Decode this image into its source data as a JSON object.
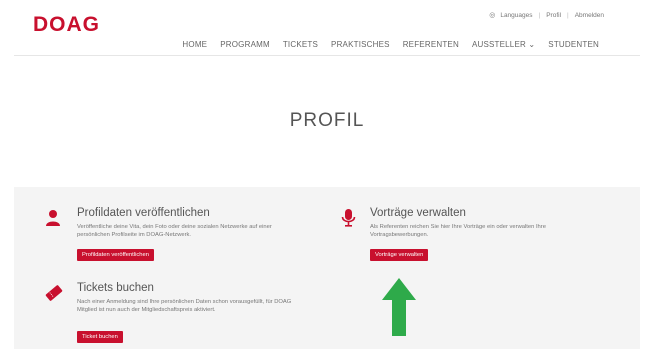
{
  "brand": {
    "logo": "DOAG"
  },
  "toplinks": {
    "languages": "Languages",
    "profil": "Profil",
    "abmelden": "Abmelden",
    "separator": "|"
  },
  "nav": {
    "items": [
      {
        "label": "HOME"
      },
      {
        "label": "PROGRAMM"
      },
      {
        "label": "TICKETS"
      },
      {
        "label": "PRAKTISCHES"
      },
      {
        "label": "REFERENTEN"
      },
      {
        "label": "AUSSTELLER ⌄"
      },
      {
        "label": "STUDENTEN"
      }
    ]
  },
  "page": {
    "title": "PROFIL"
  },
  "cards": {
    "profil": {
      "icon": "user-icon",
      "title": "Profildaten veröffentlichen",
      "text": "Veröffentliche deine Vita, dein Foto oder deine sozialen Netzwerke auf einer persönlichen Profilseite im DOAG-Netzwerk.",
      "button": "Profildaten veröffentlichen"
    },
    "vortraege": {
      "icon": "microphone-icon",
      "title": "Vorträge verwalten",
      "text": "Als Referenten reichen Sie hier Ihre Vorträge ein oder verwalten Ihre Vortragsbewerbungen.",
      "button": "Vorträge verwalten"
    },
    "tickets": {
      "icon": "ticket-icon",
      "title": "Tickets buchen",
      "text": "Nach einer Anmeldung sind Ihre persönlichen Daten schon vorausgefüllt, für DOAG Mitglied ist nun auch der Mitgliedschaftspreis aktiviert.",
      "button": "Ticket buchen"
    }
  },
  "colors": {
    "brand": "#c8102e",
    "arrow": "#2eaa4a",
    "band": "#f4f4f4"
  }
}
